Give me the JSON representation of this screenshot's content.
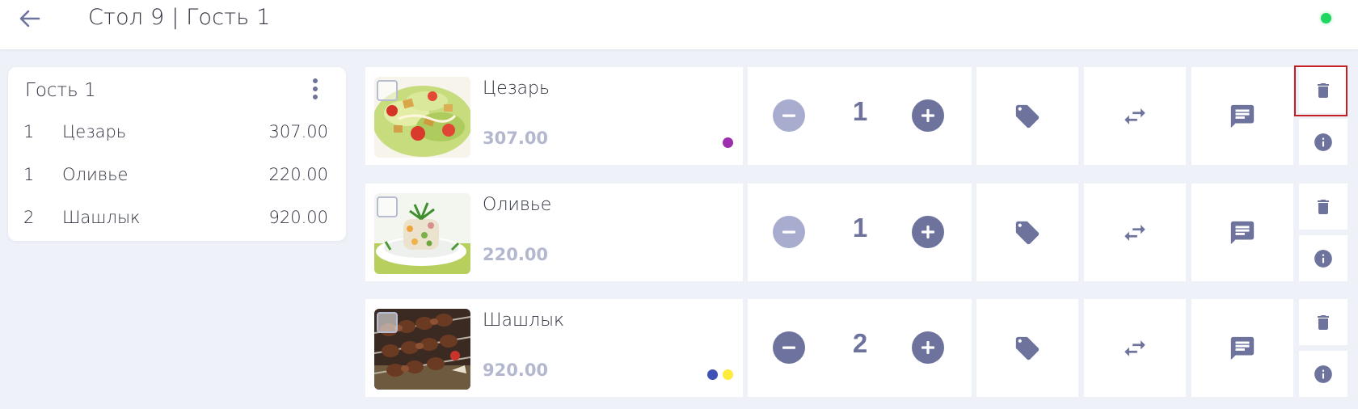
{
  "header": {
    "title": "Стол 9 | Гость 1",
    "status_color": "#1ed760"
  },
  "guest_summary": {
    "name": "Гость 1",
    "items": [
      {
        "qty": "1",
        "name": "Цезарь",
        "price": "307.00"
      },
      {
        "qty": "1",
        "name": "Оливье",
        "price": "220.00"
      },
      {
        "qty": "2",
        "name": "Шашлык",
        "price": "920.00"
      }
    ]
  },
  "orders": [
    {
      "name": "Цезарь",
      "price": "307.00",
      "qty": "1",
      "minus_enabled": false,
      "tags": [
        "#9b2fae"
      ]
    },
    {
      "name": "Оливье",
      "price": "220.00",
      "qty": "1",
      "minus_enabled": false,
      "tags": []
    },
    {
      "name": "Шашлык",
      "price": "920.00",
      "qty": "2",
      "minus_enabled": true,
      "tags": [
        "#3f51b5",
        "#ffeb3b"
      ]
    }
  ],
  "icons": {
    "back": "arrow-left-icon",
    "menu": "more-vertical-icon",
    "discount": "tag-icon",
    "move": "swap-arrows-icon",
    "comment": "comment-icon",
    "delete": "trash-icon",
    "info": "info-icon"
  },
  "colors": {
    "accent": "#6d739c",
    "minus_disabled": "#a8add0",
    "price_muted": "#b3b8cf",
    "background": "#eff1f8",
    "highlight": "#c61d23"
  }
}
